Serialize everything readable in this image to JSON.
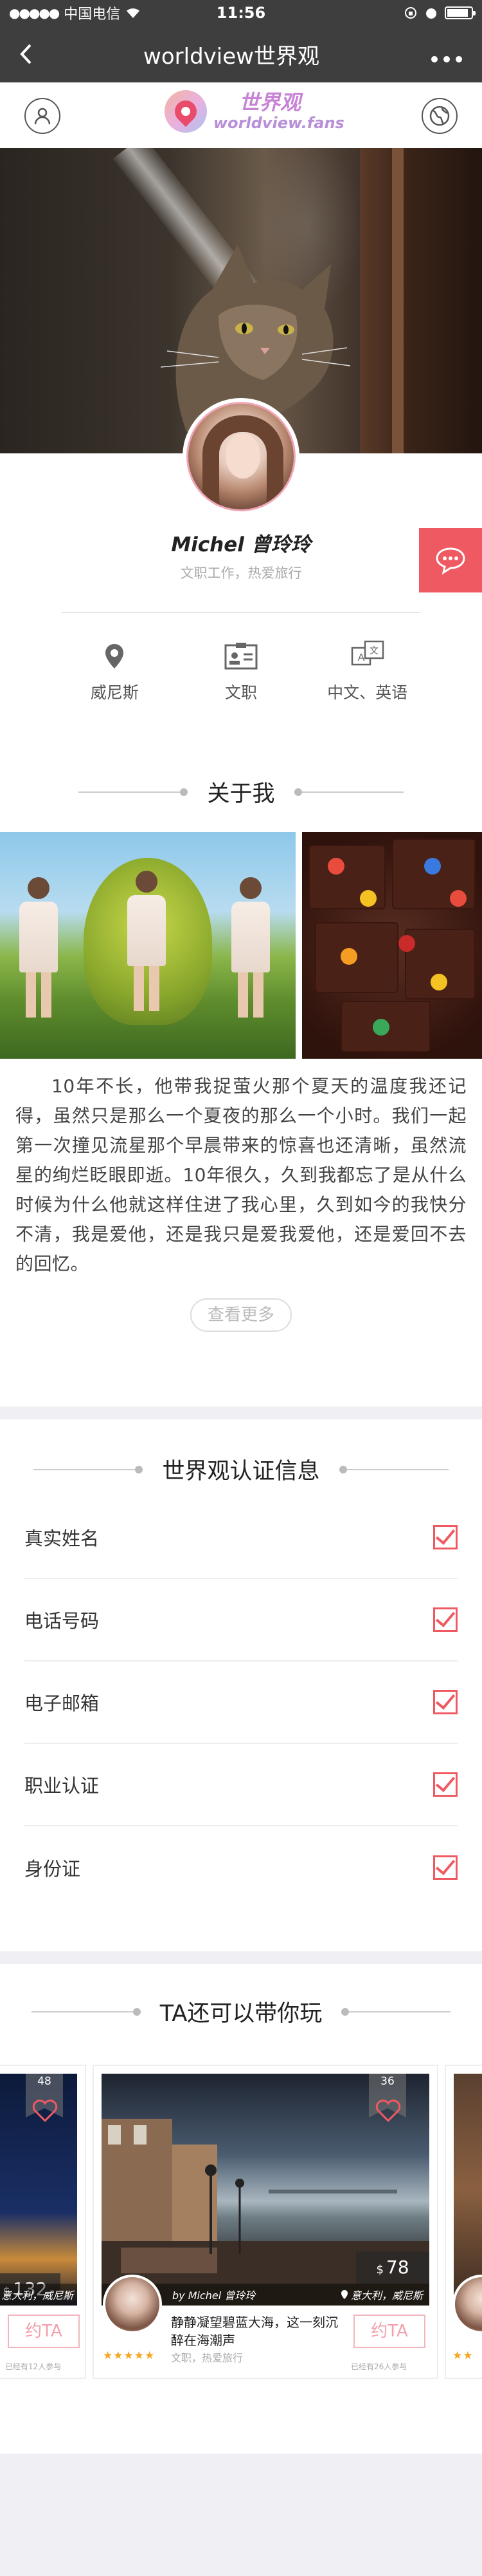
{
  "status_bar": {
    "carrier": "中国电信",
    "time": "11:56"
  },
  "nav": {
    "title": "worldview世界观",
    "back_icon": "chevron-left-icon",
    "more_icon": "more-dots-icon"
  },
  "header": {
    "logo_cn": "世界观",
    "logo_en": "worldview.fans",
    "left_icon": "user-icon",
    "right_icon": "globe-icon"
  },
  "profile": {
    "name": "Michel 曾玲玲",
    "subtitle": "文职工作，热爱旅行",
    "meta": [
      {
        "icon": "location-pin-icon",
        "label": "威尼斯"
      },
      {
        "icon": "id-card-icon",
        "label": "文职"
      },
      {
        "icon": "language-icon",
        "label": "中文、英语"
      }
    ]
  },
  "about": {
    "title": "关于我",
    "text": "10年不长，他带我捉萤火那个夏天的温度我还记得，虽然只是那么一个夏夜的那么一个小时。我们一起第一次撞见流星那个早晨带来的惊喜也还清晰，虽然流星的绚烂眨眼即逝。10年很久，久到我都忘了是从什么时候为什么他就这样住进了我心里，久到如今的我快分不清，我是爱他，还是我只是爱我爱他，还是爱回不去的回忆。",
    "more_label": "查看更多"
  },
  "verify": {
    "title": "世界观认证信息",
    "items": [
      {
        "label": "真实姓名",
        "checked": true
      },
      {
        "label": "电话号码",
        "checked": true
      },
      {
        "label": "电子邮箱",
        "checked": true
      },
      {
        "label": "职业认证",
        "checked": true
      },
      {
        "label": "身份证",
        "checked": true
      }
    ]
  },
  "play": {
    "title": "TA还可以带你玩",
    "cards": [
      {
        "likes": "48",
        "price": "132",
        "currency": "$",
        "cta": "约TA",
        "joined": "已经有12人参与"
      },
      {
        "likes": "36",
        "price": "78",
        "currency": "$",
        "cta": "约TA",
        "joined": "已经有26人参与",
        "author": "by  Michel 曾玲玲",
        "location": "意大利，威尼斯",
        "desc": "静静凝望碧蓝大海，这一刻沉醉在海潮声",
        "host_sub": "文职，热爱旅行",
        "stars": "★★★★★"
      },
      {
        "stars": "★★"
      }
    ],
    "card_left_location": "意大利，威尼斯"
  }
}
